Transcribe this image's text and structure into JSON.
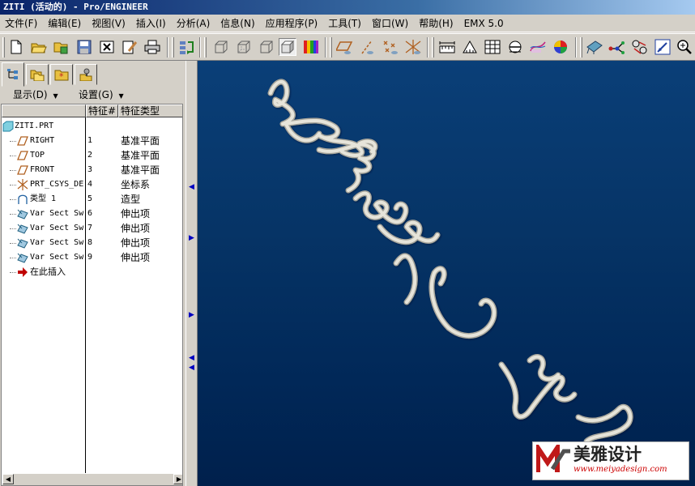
{
  "window": {
    "title": "ZITI (活动的) - Pro/ENGINEER"
  },
  "menu": {
    "items": [
      "文件(F)",
      "编辑(E)",
      "视图(V)",
      "插入(I)",
      "分析(A)",
      "信息(N)",
      "应用程序(P)",
      "工具(T)",
      "窗口(W)",
      "帮助(H)",
      "EMX 5.0"
    ]
  },
  "toolbar": {
    "groups": [
      [
        "new-file-icon",
        "open-folder-icon",
        "open-session-icon",
        "save-icon",
        "erase-icon",
        "edit-page-icon",
        "print-icon"
      ],
      [
        "regenerate-icon"
      ],
      [
        "wireframe-icon",
        "hidden-line-icon",
        "no-hidden-icon",
        "shading-icon",
        "color-appearance-icon"
      ],
      [
        "datum-plane-icon",
        "datum-axis-icon",
        "datum-point-icon",
        "datum-csys-icon"
      ],
      [
        "measure-distance-icon",
        "measure-angle-icon",
        "table-icon",
        "section-icon",
        "sketch-icon",
        "color-sphere-icon"
      ],
      [
        "spin-icon",
        "connect-icon",
        "simulate-icon",
        "edit-icon",
        "zoom-icon"
      ]
    ]
  },
  "navigator": {
    "tabs": [
      "model-tree-icon",
      "folder-browser-icon",
      "favorites-icon",
      "connections-icon"
    ],
    "show_label": "显示(D)",
    "settings_label": "设置(G)",
    "columns": {
      "name": "",
      "feature_num": "特征#",
      "feature_type": "特征类型"
    },
    "root": "ZITI.PRT",
    "rows": [
      {
        "name": "RIGHT",
        "num": "1",
        "type": "基准平面",
        "icon": "datum-plane-icon"
      },
      {
        "name": "TOP",
        "num": "2",
        "type": "基准平面",
        "icon": "datum-plane-icon"
      },
      {
        "name": "FRONT",
        "num": "3",
        "type": "基准平面",
        "icon": "datum-plane-icon"
      },
      {
        "name": "PRT_CSYS_DE",
        "num": "4",
        "type": "坐标系",
        "icon": "csys-icon"
      },
      {
        "name": "类型 1",
        "num": "5",
        "type": "造型",
        "icon": "style-icon"
      },
      {
        "name": "Var Sect Sw",
        "num": "6",
        "type": "伸出项",
        "icon": "var-sweep-icon"
      },
      {
        "name": "Var Sect Sw",
        "num": "7",
        "type": "伸出项",
        "icon": "var-sweep-icon"
      },
      {
        "name": "Var Sect Sw",
        "num": "8",
        "type": "伸出项",
        "icon": "var-sweep-icon"
      },
      {
        "name": "Var Sect Sw",
        "num": "9",
        "type": "伸出项",
        "icon": "var-sweep-icon"
      },
      {
        "name": "在此插入",
        "num": "",
        "type": "",
        "icon": "insert-here-arrow-icon"
      }
    ]
  },
  "watermark": {
    "name": "美雅设计",
    "url": "www.meiyadesign.com"
  },
  "colors": {
    "titlebar": "#0a246a",
    "viewport": "#063466",
    "stroke": "#d8d6cc"
  }
}
